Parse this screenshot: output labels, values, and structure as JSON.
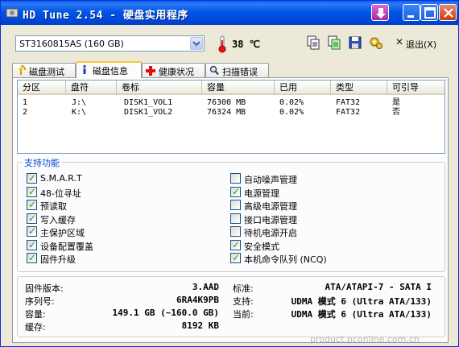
{
  "window": {
    "title": "HD Tune 2.54 - 硬盘实用程序"
  },
  "toolbar": {
    "drive": "ST3160815AS (160 GB)",
    "temperature": "38 ℃",
    "exit_label": "退出(X)",
    "icons": [
      "copy-icon",
      "copy-all-icon",
      "save-icon",
      "options-icon"
    ]
  },
  "tabs": [
    {
      "label": "磁盘测试",
      "icon": "benchmark-icon"
    },
    {
      "label": "磁盘信息",
      "icon": "info-icon",
      "active": true
    },
    {
      "label": "健康状况",
      "icon": "health-icon"
    },
    {
      "label": "扫描错误",
      "icon": "scan-icon"
    }
  ],
  "partitions": {
    "headers": [
      "分区",
      "盘符",
      "卷标",
      "容量",
      "已用",
      "类型",
      "可引导"
    ],
    "rows": [
      [
        "1",
        "J:\\",
        "DISK1_VOL1",
        "76300 MB",
        "0.02%",
        "FAT32",
        "是"
      ],
      [
        "2",
        "K:\\",
        "DISK1_VOL2",
        "76324 MB",
        "0.02%",
        "FAT32",
        "否"
      ]
    ]
  },
  "features": {
    "title": "支持功能",
    "left": [
      {
        "label": "S.M.A.R.T",
        "checked": true
      },
      {
        "label": "48-位寻址",
        "checked": true
      },
      {
        "label": "预读取",
        "checked": true
      },
      {
        "label": "写入缓存",
        "checked": true
      },
      {
        "label": "主保护区域",
        "checked": true
      },
      {
        "label": "设备配置覆盖",
        "checked": true
      },
      {
        "label": "固件升级",
        "checked": true
      }
    ],
    "right": [
      {
        "label": "自动噪声管理",
        "checked": false
      },
      {
        "label": "电源管理",
        "checked": true
      },
      {
        "label": "高级电源管理",
        "checked": false
      },
      {
        "label": "接口电源管理",
        "checked": false
      },
      {
        "label": "待机电源开启",
        "checked": false
      },
      {
        "label": "安全模式",
        "checked": true
      },
      {
        "label": "本机命令队列 (NCQ)",
        "checked": true
      }
    ]
  },
  "info": {
    "firmware_label": "固件版本:",
    "firmware": "3.AAD",
    "serial_label": "序列号:",
    "serial": "6RA4K9PB",
    "capacity_label": "容量:",
    "capacity": "149.1 GB (~160.0 GB)",
    "buffer_label": "缓存:",
    "buffer": "8192 KB",
    "standard_label": "标准:",
    "standard": "ATA/ATAPI-7 - SATA I",
    "supported_label": "支持:",
    "supported": "UDMA 模式 6 (Ultra ATA/133)",
    "active_label": "当前:",
    "active": "UDMA 模式 6 (Ultra ATA/133)"
  },
  "watermark": "product.pconline.com.cn"
}
